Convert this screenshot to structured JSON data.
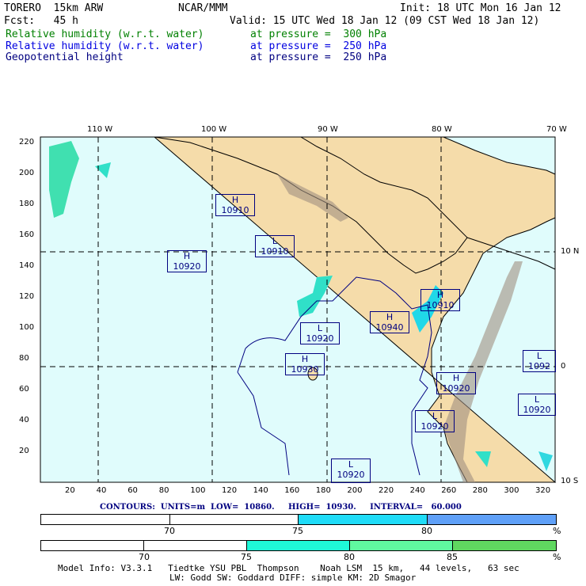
{
  "header": {
    "model": "TORERO  15km ARW",
    "org": "NCAR/MMM",
    "init": "Init: 18 UTC Mon 16 Jan 12",
    "fcst": "Fcst:   45 h",
    "valid": "Valid: 15 UTC Wed 18 Jan 12 (09 CST Wed 18 Jan 12)"
  },
  "fields": [
    {
      "name": "Relative humidity (w.r.t. water)",
      "level": "at pressure =  300 hPa",
      "color": "#008000"
    },
    {
      "name": "Relative humidity (w.r.t. water)",
      "level": "at pressure =  250 hPa",
      "color": "#0000e0"
    },
    {
      "name": "Geopotential height",
      "level": "at pressure =  250 hPa",
      "color": "#000080"
    }
  ],
  "map": {
    "lon_labels": [
      "110 W",
      "100 W",
      "90 W",
      "80 W",
      "70 W"
    ],
    "lat_labels": [
      "10 N",
      "0",
      "10 S"
    ],
    "y_ticks": [
      "220",
      "200",
      "180",
      "160",
      "140",
      "120",
      "100",
      "80",
      "60",
      "40",
      "20"
    ],
    "x_ticks": [
      "20",
      "40",
      "60",
      "80",
      "100",
      "120",
      "140",
      "160",
      "180",
      "200",
      "220",
      "240",
      "260",
      "280",
      "300",
      "320"
    ],
    "centers": [
      {
        "type": "H",
        "value": "10910"
      },
      {
        "type": "L",
        "value": "10910"
      },
      {
        "type": "H",
        "value": "10920"
      },
      {
        "type": "H",
        "value": "10910"
      },
      {
        "type": "H",
        "value": "10940"
      },
      {
        "type": "L",
        "value": "10920"
      },
      {
        "type": "H",
        "value": "10930"
      },
      {
        "type": "H",
        "value": "10920"
      },
      {
        "type": "L",
        "value": "10920"
      },
      {
        "type": "L",
        "value": "1092"
      },
      {
        "type": "L",
        "value": "10920"
      },
      {
        "type": "L",
        "value": "10920"
      }
    ]
  },
  "contours": "CONTOURS:  UNITS=m  LOW=  10860.     HIGH=  10930.     INTERVAL=   60.000",
  "bar1": {
    "labels": [
      "70",
      "75",
      "80",
      "%"
    ],
    "colors": [
      "#ffffff",
      "#ffffff",
      "#1fdcf8",
      "#5fa0f8"
    ]
  },
  "bar2": {
    "labels": [
      "70",
      "75",
      "80",
      "85",
      "%"
    ],
    "colors": [
      "#ffffff",
      "#ffffff",
      "#1ff8d8",
      "#60f8a0",
      "#60d860"
    ]
  },
  "footer": {
    "line1": "Model Info: V3.3.1   Tiedtke YSU PBL  Thompson    Noah LSM  15 km,   44 levels,   63 sec",
    "line2": "LW: Godd SW: Goddard DIFF: simple KM: 2D Smagor"
  }
}
